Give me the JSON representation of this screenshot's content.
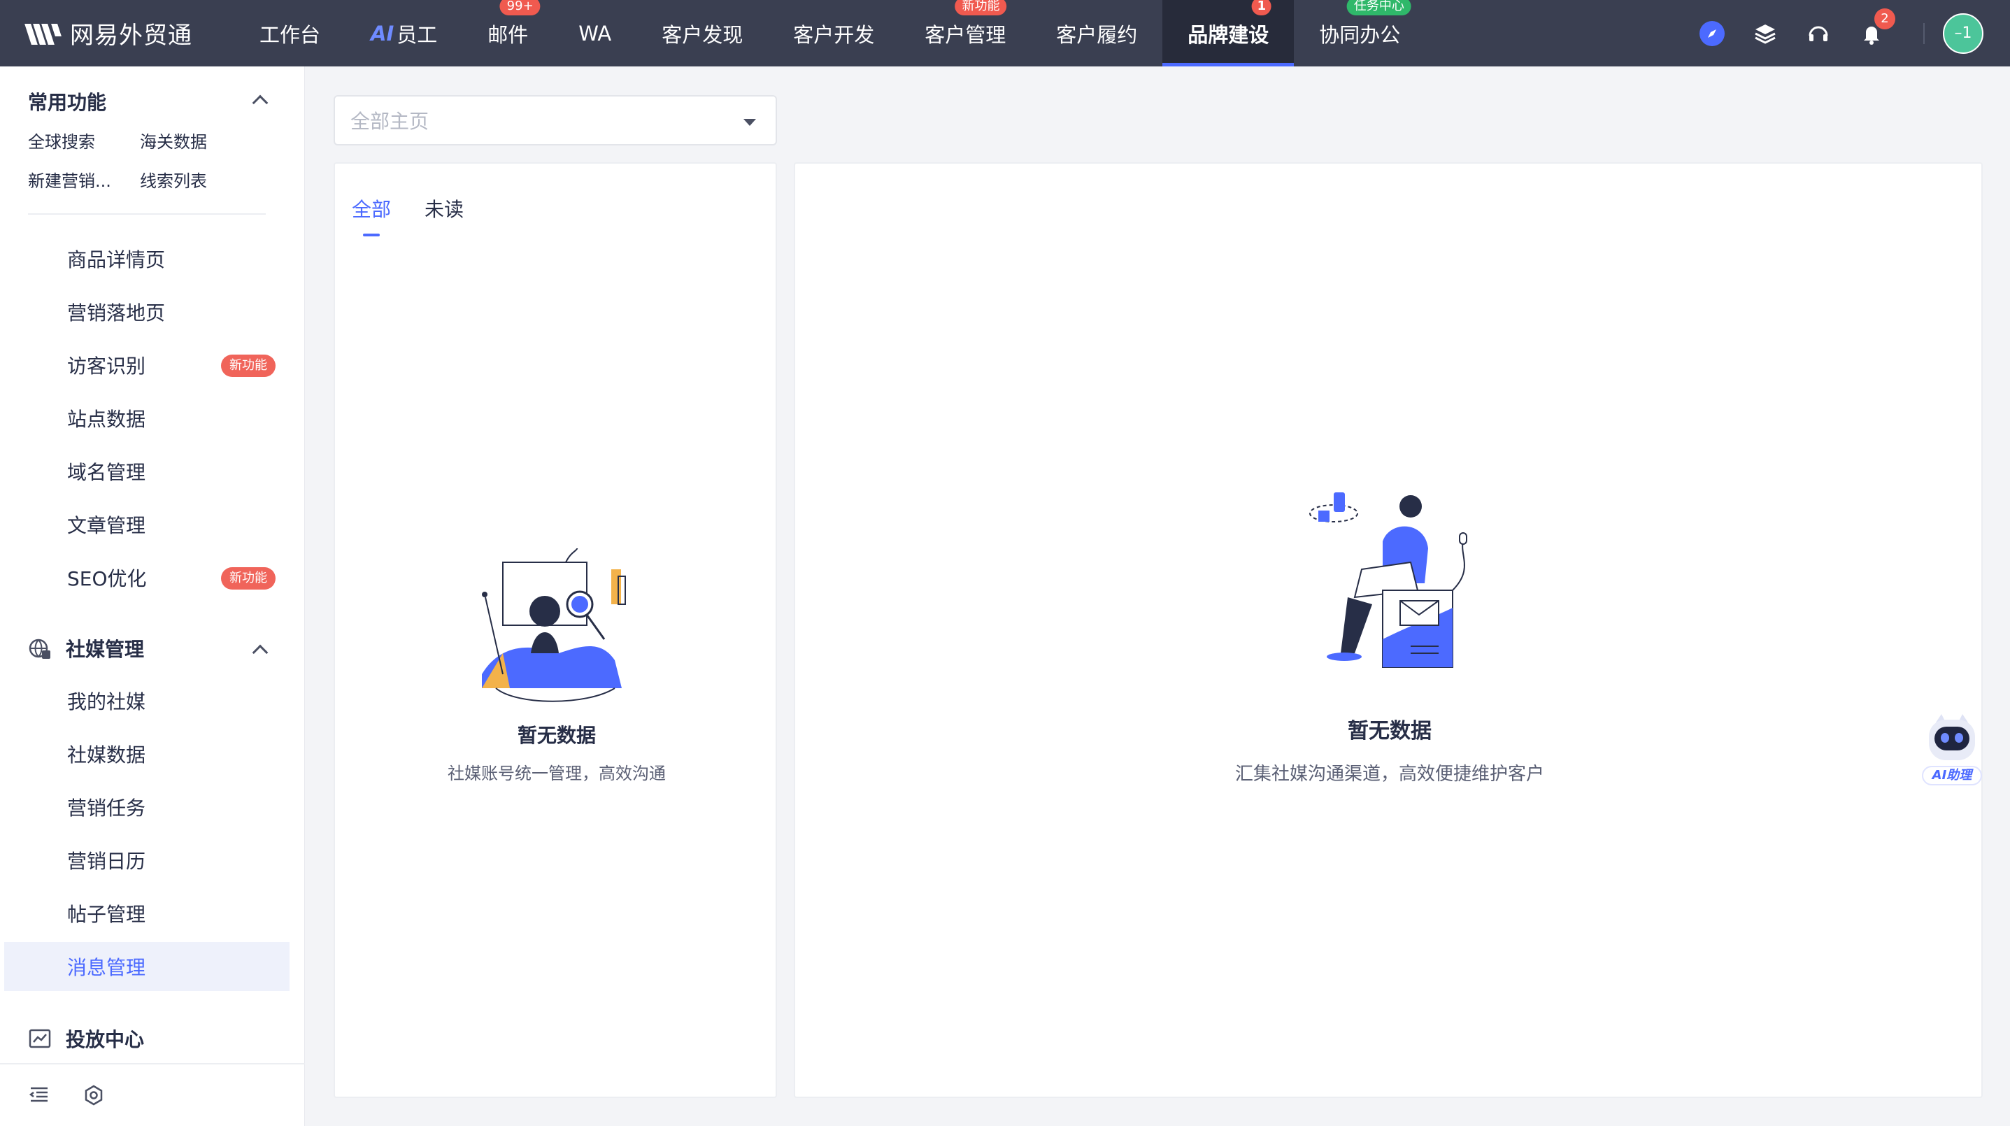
{
  "app": {
    "logo_text": "网易外贸通",
    "colors": {
      "topbar": "#3a3f51",
      "accent": "#4c6aff",
      "badge": "#f05a4f",
      "badge_green": "#2fb86a"
    }
  },
  "nav": {
    "items": [
      {
        "label": "工作台"
      },
      {
        "label": "员工",
        "prefix": "AI"
      },
      {
        "label": "邮件",
        "badge": "99+"
      },
      {
        "label": "WA"
      },
      {
        "label": "客户发现"
      },
      {
        "label": "客户开发"
      },
      {
        "label": "客户管理",
        "badge": "新功能"
      },
      {
        "label": "客户履约"
      },
      {
        "label": "品牌建设",
        "badge": "1",
        "active": true
      },
      {
        "label": "协同办公",
        "badge": "任务中心"
      }
    ],
    "right": {
      "notification_count": "2",
      "avatar_text": "–1",
      "icons": [
        "compass-icon",
        "layers-icon",
        "headset-icon",
        "bell-icon"
      ]
    }
  },
  "sidebar": {
    "common": {
      "title": "常用功能",
      "links": [
        "全球搜索",
        "海关数据",
        "新建营销...",
        "线索列表"
      ]
    },
    "site_items": [
      {
        "label": "商品详情页"
      },
      {
        "label": "营销落地页"
      },
      {
        "label": "访客识别",
        "tag": "新功能"
      },
      {
        "label": "站点数据"
      },
      {
        "label": "域名管理"
      },
      {
        "label": "文章管理"
      },
      {
        "label": "SEO优化",
        "tag": "新功能"
      }
    ],
    "social": {
      "title": "社媒管理",
      "items": [
        {
          "label": "我的社媒"
        },
        {
          "label": "社媒数据"
        },
        {
          "label": "营销任务"
        },
        {
          "label": "营销日历"
        },
        {
          "label": "帖子管理"
        },
        {
          "label": "消息管理",
          "active": true
        }
      ]
    },
    "ads": {
      "title": "投放中心"
    }
  },
  "main": {
    "selector": {
      "placeholder": "全部主页"
    },
    "tabs": [
      {
        "label": "全部",
        "active": true
      },
      {
        "label": "未读"
      }
    ],
    "left_empty": {
      "title": "暂无数据",
      "subtitle": "社媒账号统一管理，高效沟通"
    },
    "right_empty": {
      "title": "暂无数据",
      "subtitle": "汇集社媒沟通渠道，高效便捷维护客户"
    }
  },
  "assistant": {
    "label": "AI助理"
  }
}
